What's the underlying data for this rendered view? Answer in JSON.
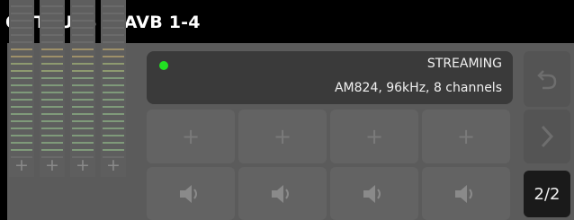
{
  "header": {
    "title": "OUTPUTS > AVB 1-4"
  },
  "status": {
    "state": "STREAMING",
    "detail": "AM824, 96kHz, 8 channels",
    "indicator_color": "#22e022"
  },
  "meters": [
    {
      "add_label": "+"
    },
    {
      "add_label": "+"
    },
    {
      "add_label": "+"
    },
    {
      "add_label": "+"
    }
  ],
  "grid": {
    "plus_glyph": "+",
    "speaker_icon": "speaker-icon"
  },
  "side": {
    "undo_icon": "undo-icon",
    "next_icon": "chevron-right-icon",
    "page": "2/2"
  }
}
